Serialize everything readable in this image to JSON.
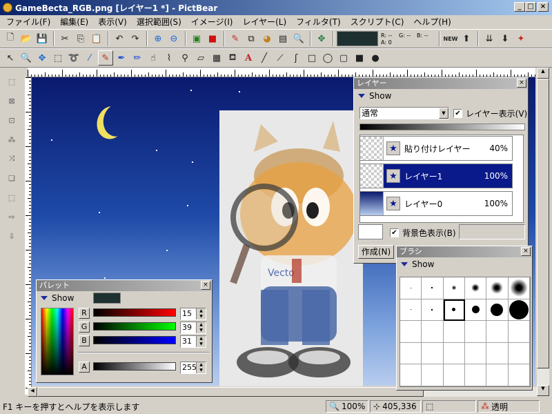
{
  "window": {
    "title": "GameBecta_RGB.png [レイヤー1 *] - PictBear"
  },
  "caption_buttons": {
    "minimize": "_",
    "maximize": "□",
    "close": "×"
  },
  "menu": [
    "ファイル(F)",
    "編集(E)",
    "表示(V)",
    "選択範囲(S)",
    "イメージ(I)",
    "レイヤー(L)",
    "フィルタ(T)",
    "スクリプト(C)",
    "ヘルプ(H)"
  ],
  "toolbar_color": {
    "r": "R: --",
    "g": "G: --",
    "b": "B: --",
    "a": "A: 0",
    "swatch": "#1f3030"
  },
  "layer_panel": {
    "title": "レイヤー",
    "show": "Show",
    "blend_mode": "通常",
    "visible_label": "レイヤー表示(V)",
    "layers": [
      {
        "name": "貼り付けレイヤー",
        "opacity": "40%"
      },
      {
        "name": "レイヤー1",
        "opacity": "100%"
      },
      {
        "name": "レイヤー0",
        "opacity": "100%"
      }
    ],
    "bg_label": "背景色表示(B)",
    "create_button": "作成(N)"
  },
  "brush_panel": {
    "title": "ブラシ",
    "show": "Show"
  },
  "palette_panel": {
    "title": "パレット",
    "show": "Show",
    "current_color": "#1f3030",
    "channels": [
      {
        "label": "R",
        "value": "15",
        "color": "#ff0000"
      },
      {
        "label": "G",
        "value": "39",
        "color": "#00ff00"
      },
      {
        "label": "B",
        "value": "31",
        "color": "#0000ff"
      }
    ],
    "alpha": {
      "label": "A",
      "value": "255"
    }
  },
  "status": {
    "help": "F1 キーを押すとヘルプを表示します",
    "zoom": "100%",
    "coords": "405,336",
    "mode": "透明"
  }
}
